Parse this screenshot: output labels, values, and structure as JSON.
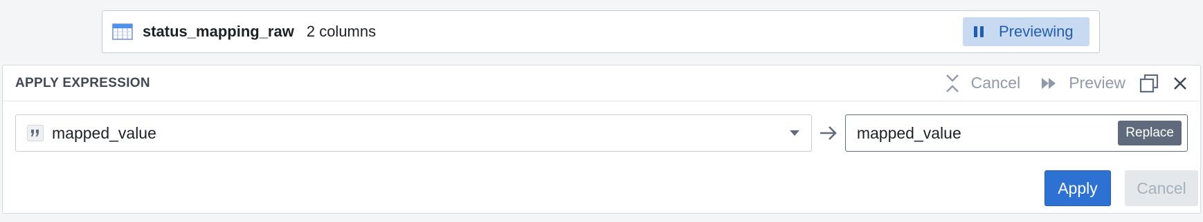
{
  "dataset": {
    "name": "status_mapping_raw",
    "column_count": "2 columns",
    "preview_button_label": "Previewing"
  },
  "panel": {
    "title": "APPLY EXPRESSION",
    "header_actions": {
      "cancel_label": "Cancel",
      "preview_label": "Preview"
    },
    "input_column": {
      "selected_value": "mapped_value",
      "type_icon": "string-quote-icon"
    },
    "output_column": {
      "value": "mapped_value",
      "mode_tag": "Replace"
    },
    "footer": {
      "apply_label": "Apply",
      "cancel_label": "Cancel"
    }
  },
  "colors": {
    "accent": "#2d72d2",
    "preview_bg": "#c8d9f2",
    "muted_text": "#8f99a8",
    "tag_bg": "#5f6b7c"
  }
}
